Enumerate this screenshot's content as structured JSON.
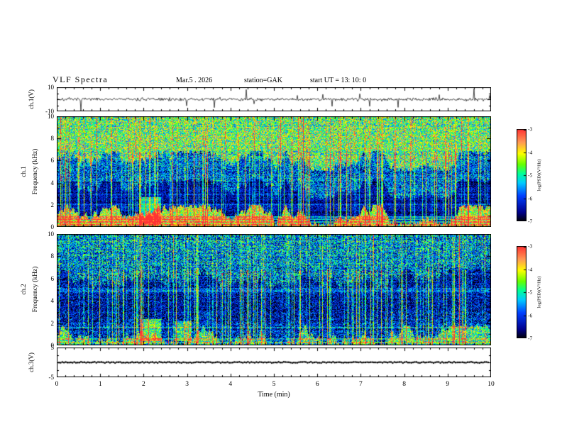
{
  "title": {
    "main": "VLF Spectra",
    "date": "Mar.5 . 2026",
    "station": "station=GAK",
    "start_ut": "start UT =  13: 10: 0"
  },
  "x_axis": {
    "label": "Time (min)",
    "tick_labels": [
      "0",
      "1",
      "2",
      "3",
      "4",
      "5",
      "6",
      "7",
      "8",
      "9",
      "10"
    ],
    "range_min": 0,
    "range_max": 10
  },
  "panels": {
    "wave": {
      "label": "ch.1(V)",
      "y_top_label": "10",
      "y_bottom_label": "-10"
    },
    "spec1": {
      "channel_label": "ch.1",
      "axis_label": "Frequency (kHz)",
      "tick_labels": [
        "10",
        "8",
        "6",
        "4",
        "2",
        "0"
      ]
    },
    "spec2": {
      "channel_label": "ch.2",
      "axis_label": "Frequency (kHz)",
      "tick_labels": [
        "10",
        "8",
        "6",
        "4",
        "2",
        "0"
      ]
    },
    "ch3": {
      "label": "ch.3(V)",
      "y_top_label": "5",
      "y_bottom_label": "-5"
    }
  },
  "colorbar": {
    "label": "log(PSD)(V²/Hz)",
    "tick_labels": [
      "-3",
      "-4",
      "-5",
      "-6",
      "-7"
    ],
    "stops": [
      {
        "p": 0.0,
        "c": "#000000"
      },
      {
        "p": 0.1,
        "c": "#00008c"
      },
      {
        "p": 0.28,
        "c": "#0040ff"
      },
      {
        "p": 0.42,
        "c": "#00ccff"
      },
      {
        "p": 0.52,
        "c": "#00ff99"
      },
      {
        "p": 0.62,
        "c": "#66ff00"
      },
      {
        "p": 0.74,
        "c": "#ffff00"
      },
      {
        "p": 0.86,
        "c": "#ff9955"
      },
      {
        "p": 1.0,
        "c": "#ff3333"
      }
    ]
  },
  "chart_data": [
    {
      "type": "line",
      "panel": "ch.1(V) waveform",
      "xlabel": "Time (min)",
      "xlim": [
        0,
        10
      ],
      "ylabel": "ch.1(V)",
      "ylim": [
        -10,
        10
      ],
      "summary": "Broadband noisy voltage trace fluctuating about 0 V (roughly ±2 V) with frequent impulsive spikes, mostly downward, reaching about ±9 V",
      "gen": {
        "seed": 7,
        "amp": 1.3,
        "spike_prob": 0.03,
        "spike_min": 3,
        "spike_max": 9
      }
    },
    {
      "type": "heatmap",
      "panel": "ch.1 spectrogram",
      "xlabel": "Time (min)",
      "xlim": [
        0,
        10
      ],
      "ylabel": "Frequency (kHz)",
      "ylim": [
        0,
        10
      ],
      "zlabel": "log(PSD)(V²/Hz)",
      "zlim": [
        -7,
        -3
      ],
      "summary": "Intense broadband power (yellow/green/red, PSD ~ -4 to -3) above ~6 kHz, dark (PSD ~ -7) 1-4 kHz region crossed by dense vertical sferic streaks, and strong orange/red horizontal harmonic bands below ~1 kHz",
      "gen": {
        "seed": 101,
        "bands": [
          {
            "f0": 6,
            "f1": 10,
            "base": 0.58,
            "noise": 0.28
          },
          {
            "f0": 3.5,
            "f1": 6,
            "base": 0.3,
            "noise": 0.26
          },
          {
            "f0": 1.1,
            "f1": 3.5,
            "base": 0.13,
            "noise": 0.16
          },
          {
            "f0": 0,
            "f1": 1.1,
            "base": 0.68,
            "noise": 0.25
          }
        ],
        "lines": [
          {
            "f": 0.25,
            "boost": 0.3
          },
          {
            "f": 0.5,
            "boost": 0.35
          },
          {
            "f": 0.75,
            "boost": 0.3
          },
          {
            "f": 0.95,
            "boost": 0.25
          },
          {
            "f": 2.1,
            "boost": 0.1
          },
          {
            "f": 3.0,
            "boost": 0.08
          }
        ],
        "blobs": [
          {
            "x": 2.15,
            "f": 1.5,
            "w": 0.25,
            "fh": 1.2,
            "boost": 0.35
          }
        ],
        "streak_prob": 0.22,
        "streak_amp": 0.5,
        "burst_prob": 0.03,
        "burst_amp": 0.35
      }
    },
    {
      "type": "heatmap",
      "panel": "ch.2 spectrogram",
      "xlabel": "Time (min)",
      "xlim": [
        0,
        10
      ],
      "ylabel": "Frequency (kHz)",
      "ylim": [
        0,
        10
      ],
      "zlabel": "log(PSD)(V²/Hz)",
      "zlim": [
        -7,
        -3
      ],
      "summary": "Weaker than ch.1: mostly dark blue/black with dense vertical sferic streaks, blue-green speckle above ~6 kHz, green horizontal band near 1.5-2 kHz and a bright green/yellow band below ~0.8 kHz",
      "gen": {
        "seed": 202,
        "bands": [
          {
            "f0": 6,
            "f1": 10,
            "base": 0.34,
            "noise": 0.3
          },
          {
            "f0": 2.6,
            "f1": 6,
            "base": 0.16,
            "noise": 0.22
          },
          {
            "f0": 0.9,
            "f1": 2.6,
            "base": 0.2,
            "noise": 0.24
          },
          {
            "f0": 0,
            "f1": 0.9,
            "base": 0.52,
            "noise": 0.28
          }
        ],
        "lines": [
          {
            "f": 0.3,
            "boost": 0.25
          },
          {
            "f": 0.6,
            "boost": 0.25
          },
          {
            "f": 1.6,
            "boost": 0.2
          },
          {
            "f": 4.9,
            "boost": 0.12
          },
          {
            "f": 5.1,
            "boost": 0.1
          }
        ],
        "blobs": [
          {
            "x": 2.15,
            "f": 1.4,
            "w": 0.25,
            "fh": 1.0,
            "boost": 0.35
          },
          {
            "x": 2.9,
            "f": 1.3,
            "w": 0.2,
            "fh": 0.9,
            "boost": 0.3
          }
        ],
        "streak_prob": 0.2,
        "streak_amp": 0.45,
        "burst_prob": 0.02,
        "burst_amp": 0.3
      }
    },
    {
      "type": "line",
      "panel": "ch.3(V) waveform",
      "xlabel": "Time (min)",
      "xlim": [
        0,
        10
      ],
      "ylabel": "ch.3(V)",
      "ylim": [
        -5,
        5
      ],
      "summary": "Constant ~0 V: heavy dotted black trace flat across the full record",
      "gen": {
        "seed": 5,
        "value": 0
      }
    }
  ]
}
